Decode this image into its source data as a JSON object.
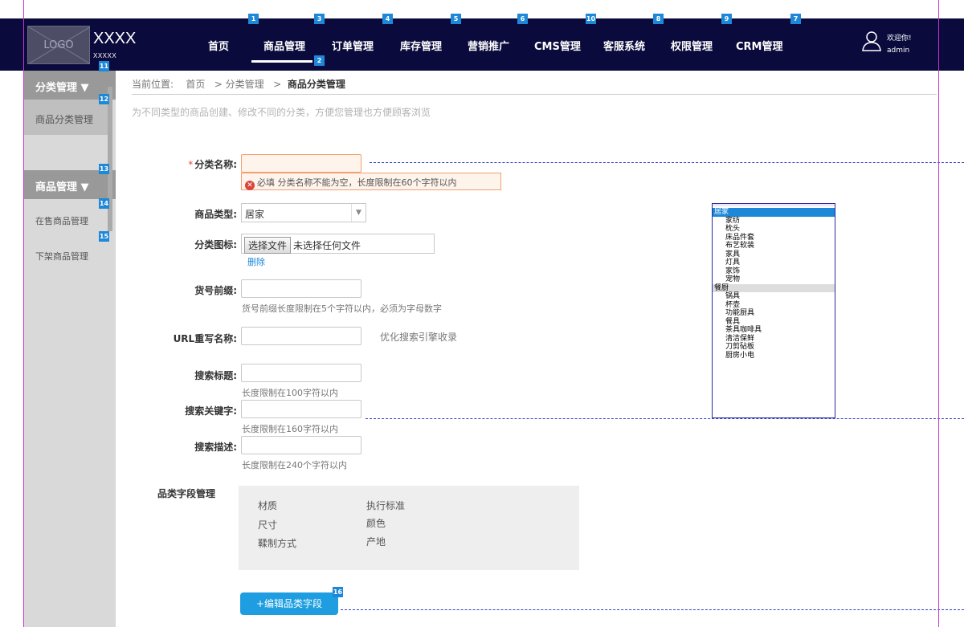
{
  "header": {
    "logo": "LOGO",
    "brand": "XXXX",
    "brand_sub": "XXXXX",
    "nav": [
      {
        "label": "首页",
        "badge": ""
      },
      {
        "label": "商品管理",
        "badge": "1"
      },
      {
        "label": "订单管理",
        "badge": "3"
      },
      {
        "label": "库存管理",
        "badge": "4"
      },
      {
        "label": "营销推广",
        "badge": "5"
      },
      {
        "label": "CMS管理",
        "badge": "6"
      },
      {
        "label": "客服系统",
        "badge": "10"
      },
      {
        "label": "权限管理",
        "badge": "8"
      },
      {
        "label": "CRM管理",
        "badge": "9"
      },
      {
        "label": "",
        "badge": "7"
      }
    ],
    "active_badge": "2",
    "welcome": "欢迎你!",
    "user": "admin"
  },
  "sidebar": {
    "sections": [
      {
        "title": "分类管理 ▼",
        "badge": "11"
      },
      {
        "title": "商品管理 ▼",
        "badge": "13"
      }
    ],
    "category_item": "商品分类管理",
    "category_badge": "12",
    "goods_items": [
      {
        "label": "在售商品管理",
        "badge": "14"
      },
      {
        "label": "下架商品管理",
        "badge": "15"
      }
    ]
  },
  "breadcrumb": {
    "prefix": "当前位置:",
    "home": "首页",
    "sep1": ">",
    "level1": "分类管理",
    "sep2": ">",
    "current": "商品分类管理"
  },
  "description": "为不同类型的商品创建、修改不同的分类，方便您管理也方便顾客浏览",
  "form": {
    "name_required": "*",
    "name_label": "分类名称:",
    "name_value": "",
    "error_icon": "✕",
    "error_text": "必填 分类名称不能为空，长度限制在60个字符以内",
    "type_label": "商品类型:",
    "type_value": "居家",
    "icon_label": "分类图标:",
    "file_button": "选择文件",
    "file_status": "未选择任何文件",
    "delete_link": "删除",
    "prefix_label": "货号前缀:",
    "prefix_hint": "货号前缀长度限制在5个字符以内，必须为字母数字",
    "url_label": "URL重写名称:",
    "url_hint": "优化搜索引擎收录",
    "seo_title_label": "搜索标题:",
    "seo_title_hint": "长度限制在100字符以内",
    "seo_keyword_label": "搜索关键字:",
    "seo_keyword_hint": "长度限制在160字符以内",
    "seo_desc_label": "搜索描述:",
    "seo_desc_hint": "长度限制在240个字符以内"
  },
  "type_dropdown": {
    "groups": [
      {
        "name": "居家",
        "selected": true,
        "options": [
          "家纺",
          "枕头",
          "床品件套",
          "布艺软装",
          "家具",
          "灯具",
          "家饰",
          "宠物"
        ]
      },
      {
        "name": "餐厨",
        "selected": false,
        "options": [
          "锅具",
          "杯壶",
          "功能厨具",
          "餐具",
          "茶具咖啡具",
          "清洁保鲜",
          "刀剪砧板",
          "厨房小电"
        ]
      }
    ]
  },
  "field_management": {
    "label": "品类字段管理",
    "fields": [
      [
        "材质",
        "执行标准"
      ],
      [
        "尺寸",
        "颜色"
      ],
      [
        "鞣制方式",
        "产地"
      ]
    ],
    "edit_button": "+编辑品类字段",
    "edit_badge": "16"
  },
  "colors": {
    "topbar": "#0a0a3c",
    "accent": "#1e88d8",
    "error": "#d9443b",
    "guide": "#cc33cc"
  }
}
